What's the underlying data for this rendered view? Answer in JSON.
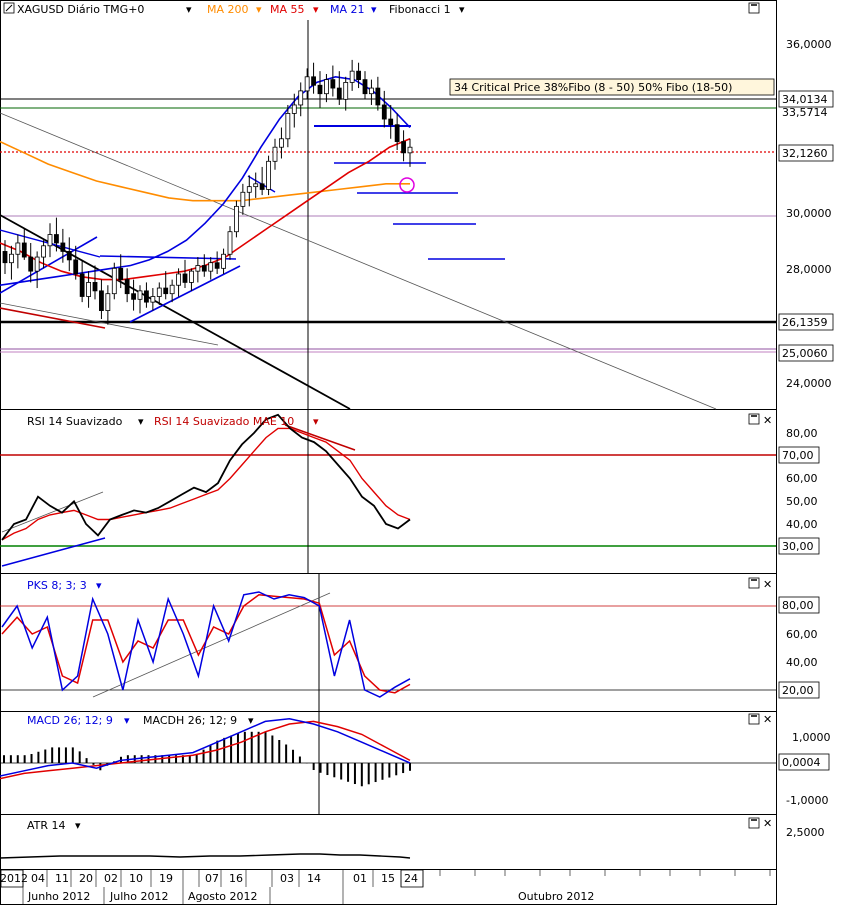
{
  "header": {
    "symbol": "XAGUSD Diário TMG+0",
    "ma200": "MA 200",
    "ma55": "MA 55",
    "ma21": "MA 21",
    "fibo": "Fibonacci 1"
  },
  "annotation": "34  Critical Price   38%Fibo (8 - 50) 50% Fibo (18-50)",
  "colors": {
    "ma200": "#ff8c00",
    "ma55": "#e00000",
    "ma21": "#0000e0",
    "candle": "#000000",
    "rsi": "#000000",
    "rsi_mae": "#e00000",
    "pks_k": "#0000e0",
    "pks_d": "#e00000",
    "macd": "#0000e0",
    "macdh": "#e00000",
    "upper_line": "#e00000",
    "lower_line": "#008000",
    "fib_circle": "#e000e0"
  },
  "price_axis": {
    "ticks": [
      "36,0000",
      "34,0134",
      "32,1260",
      "30,0000",
      "28,0000",
      "26,1359",
      "25,0060",
      "24,0000"
    ],
    "labels": [
      {
        "text": "34,0134",
        "color": "#c00000"
      },
      {
        "text": "33,5714",
        "color": "#c00000"
      },
      {
        "text": "32,1260",
        "color": "#000000"
      },
      {
        "text": "26,1359",
        "color": "#c00000"
      },
      {
        "text": "25,0060",
        "color": "#c00000"
      }
    ],
    "plain_ticks": [
      "36,0000",
      "30,0000",
      "28,0000",
      "24,0000"
    ]
  },
  "rsi_panel": {
    "title": "RSI 14 Suavizado",
    "title2": "RSI 14 Suavizado MAE 10",
    "ticks": [
      "80,00",
      "60,00",
      "50,00",
      "40,00"
    ],
    "level_high": "70,00",
    "level_low": "30,00"
  },
  "pks_panel": {
    "title": "PKS 8; 3; 3",
    "ticks": [
      "60,00",
      "40,00"
    ],
    "level_high": "80,00",
    "level_low": "20,00"
  },
  "macd_panel": {
    "title": "MACD 26; 12; 9",
    "title2": "MACDH 26; 12; 9",
    "ticks": [
      "1,0000",
      "-1,0000"
    ],
    "value": "0,0004"
  },
  "atr_panel": {
    "title": "ATR 14",
    "ticks": [
      "2,5000"
    ]
  },
  "time_axis": {
    "days": [
      "2012",
      "04",
      "11",
      "20",
      "02",
      "10",
      "19",
      "07",
      "16",
      "03",
      "14",
      "01",
      "15",
      "24"
    ],
    "months": [
      "Junho 2012",
      "Julho 2012",
      "Agosto 2012",
      "Outubro 2012"
    ]
  },
  "chart_data": {
    "type": "candlestick",
    "price_ylim": [
      23.5,
      37.5
    ],
    "candles": [
      [
        28.6,
        29.0,
        27.8,
        28.2
      ],
      [
        28.2,
        28.8,
        27.6,
        28.5
      ],
      [
        28.5,
        29.2,
        28.0,
        28.9
      ],
      [
        28.9,
        29.4,
        28.3,
        28.4
      ],
      [
        28.4,
        28.9,
        27.5,
        27.9
      ],
      [
        27.9,
        28.6,
        27.3,
        28.4
      ],
      [
        28.4,
        29.0,
        28.0,
        28.8
      ],
      [
        28.8,
        29.6,
        28.4,
        29.2
      ],
      [
        29.2,
        29.8,
        28.6,
        28.9
      ],
      [
        28.9,
        29.4,
        28.2,
        28.6
      ],
      [
        28.6,
        29.1,
        27.9,
        28.3
      ],
      [
        28.3,
        28.8,
        27.6,
        27.8
      ],
      [
        27.8,
        28.3,
        26.8,
        27.0
      ],
      [
        27.0,
        27.9,
        26.6,
        27.5
      ],
      [
        27.5,
        28.1,
        26.9,
        27.2
      ],
      [
        27.2,
        27.6,
        26.2,
        26.5
      ],
      [
        26.5,
        27.4,
        26.0,
        27.1
      ],
      [
        27.1,
        28.2,
        26.9,
        28.0
      ],
      [
        28.0,
        28.5,
        27.3,
        27.6
      ],
      [
        27.6,
        28.0,
        26.8,
        27.1
      ],
      [
        27.1,
        27.6,
        26.5,
        26.9
      ],
      [
        26.9,
        27.4,
        26.4,
        27.2
      ],
      [
        27.2,
        27.5,
        26.6,
        26.8
      ],
      [
        26.8,
        27.3,
        26.5,
        27.0
      ],
      [
        27.0,
        27.5,
        26.7,
        27.3
      ],
      [
        27.3,
        27.9,
        26.9,
        27.1
      ],
      [
        27.1,
        27.6,
        26.8,
        27.4
      ],
      [
        27.4,
        28.0,
        27.0,
        27.8
      ],
      [
        27.8,
        28.3,
        27.3,
        27.5
      ],
      [
        27.5,
        28.0,
        27.2,
        27.9
      ],
      [
        27.9,
        28.4,
        27.5,
        28.1
      ],
      [
        28.1,
        28.5,
        27.7,
        27.9
      ],
      [
        27.9,
        28.4,
        27.6,
        28.2
      ],
      [
        28.2,
        28.6,
        27.8,
        28.0
      ],
      [
        28.0,
        28.7,
        27.8,
        28.5
      ],
      [
        28.5,
        29.5,
        28.3,
        29.3
      ],
      [
        29.3,
        30.4,
        29.1,
        30.2
      ],
      [
        30.2,
        31.0,
        29.9,
        30.7
      ],
      [
        30.7,
        31.3,
        30.2,
        30.9
      ],
      [
        30.9,
        31.4,
        30.5,
        31.0
      ],
      [
        31.0,
        31.6,
        30.6,
        30.8
      ],
      [
        30.8,
        32.0,
        30.6,
        31.8
      ],
      [
        31.8,
        32.6,
        31.5,
        32.3
      ],
      [
        32.3,
        33.0,
        31.9,
        32.6
      ],
      [
        32.6,
        33.8,
        32.3,
        33.5
      ],
      [
        33.5,
        34.2,
        33.0,
        33.8
      ],
      [
        33.8,
        34.6,
        33.4,
        34.3
      ],
      [
        34.3,
        35.1,
        34.0,
        34.8
      ],
      [
        34.8,
        35.3,
        34.2,
        34.5
      ],
      [
        34.5,
        35.0,
        33.7,
        34.2
      ],
      [
        34.2,
        34.9,
        33.9,
        34.7
      ],
      [
        34.7,
        35.2,
        34.1,
        34.4
      ],
      [
        34.4,
        35.0,
        33.8,
        34.0
      ],
      [
        34.0,
        34.8,
        33.6,
        34.6
      ],
      [
        34.6,
        35.4,
        34.3,
        35.0
      ],
      [
        35.0,
        35.3,
        34.4,
        34.7
      ],
      [
        34.7,
        35.0,
        34.0,
        34.2
      ],
      [
        34.2,
        34.7,
        33.8,
        34.4
      ],
      [
        34.4,
        34.8,
        33.6,
        33.8
      ],
      [
        33.8,
        34.3,
        33.0,
        33.3
      ],
      [
        33.3,
        33.8,
        32.6,
        33.1
      ],
      [
        33.1,
        33.5,
        32.2,
        32.5
      ],
      [
        32.5,
        32.9,
        31.8,
        32.1
      ],
      [
        32.1,
        32.6,
        31.6,
        32.3
      ]
    ],
    "ma21": [
      27.4,
      27.5,
      27.6,
      27.7,
      27.8,
      27.9,
      28.0,
      28.1,
      28.3,
      28.6,
      29.0,
      29.6,
      30.3,
      31.2,
      32.3,
      33.3,
      34.1,
      34.6,
      34.8,
      34.7,
      34.3,
      33.7,
      33.0
    ],
    "ma55": [
      28.9,
      28.6,
      28.2,
      27.9,
      27.7,
      27.6,
      27.6,
      27.7,
      27.8,
      27.9,
      28.1,
      28.4,
      28.9,
      29.4,
      29.9,
      30.4,
      30.9,
      31.4,
      31.8,
      32.3,
      32.6
    ],
    "ma200": [
      32.5,
      32.1,
      31.7,
      31.4,
      31.1,
      30.9,
      30.7,
      30.5,
      30.4,
      30.4,
      30.4,
      30.5,
      30.6,
      30.7,
      30.8,
      30.9,
      31.0,
      31.0
    ],
    "rsi": [
      33,
      40,
      42,
      52,
      48,
      45,
      50,
      40,
      35,
      42,
      44,
      46,
      45,
      47,
      50,
      53,
      56,
      54,
      58,
      68,
      75,
      80,
      86,
      88,
      82,
      78,
      76,
      72,
      66,
      60,
      52,
      48,
      40,
      38,
      42
    ],
    "rsi_mae": [
      33,
      36,
      38,
      42,
      44,
      45,
      46,
      44,
      42,
      42,
      43,
      44,
      45,
      46,
      47,
      49,
      51,
      53,
      55,
      60,
      66,
      72,
      78,
      82,
      82,
      80,
      78,
      76,
      72,
      68,
      60,
      54,
      48,
      44,
      42
    ],
    "pks_k": [
      65,
      80,
      50,
      72,
      20,
      30,
      85,
      60,
      20,
      70,
      40,
      85,
      60,
      30,
      80,
      55,
      88,
      90,
      85,
      88,
      86,
      80,
      30,
      70,
      20,
      15,
      22,
      28
    ],
    "pks_d": [
      60,
      72,
      60,
      65,
      30,
      25,
      70,
      70,
      40,
      55,
      50,
      70,
      70,
      45,
      65,
      60,
      80,
      88,
      87,
      86,
      85,
      82,
      45,
      55,
      30,
      20,
      18,
      24
    ],
    "macd": [
      -0.5,
      -0.3,
      -0.1,
      0.0,
      -0.2,
      0.1,
      0.2,
      0.3,
      0.4,
      0.8,
      1.2,
      1.6,
      1.7,
      1.5,
      1.2,
      0.8,
      0.4,
      0.0
    ],
    "macd_signal": [
      -0.6,
      -0.4,
      -0.3,
      -0.2,
      -0.1,
      0.0,
      0.1,
      0.2,
      0.3,
      0.5,
      0.8,
      1.2,
      1.5,
      1.6,
      1.4,
      1.1,
      0.6,
      0.1
    ]
  }
}
